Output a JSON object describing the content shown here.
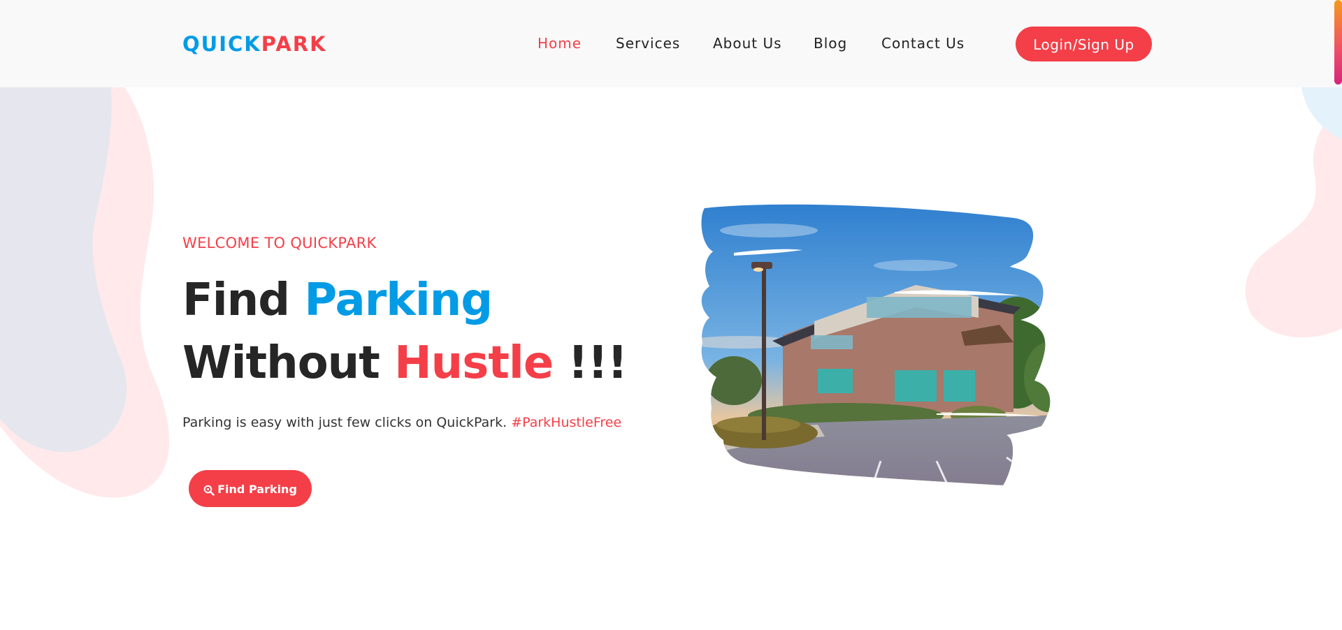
{
  "brand": {
    "part1": "QUICK",
    "part2": "PARK",
    "blue": "#039be5",
    "red": "#f43f48"
  },
  "nav": {
    "items": [
      {
        "label": "Home",
        "active": true
      },
      {
        "label": "Services",
        "active": false
      },
      {
        "label": "About Us",
        "active": false
      },
      {
        "label": "Blog",
        "active": false
      },
      {
        "label": "Contact Us",
        "active": false
      }
    ],
    "login_label": "Login/Sign Up"
  },
  "hero": {
    "eyebrow": "WELCOME TO QUICKPARK",
    "headline": {
      "word1": "Find",
      "word2": "Parking",
      "word3": "Without",
      "word4": "Hustle",
      "word5": "!!!"
    },
    "subtext": "Parking is easy with just few clicks on QuickPark.",
    "hashtag": "#ParkHustleFree",
    "cta_label": "Find Parking",
    "cta_icon": "search-location-icon"
  },
  "colors": {
    "accent_red": "#f43f48",
    "accent_blue": "#039be5",
    "header_bg": "#f9f9f9",
    "text_dark": "#262626"
  }
}
